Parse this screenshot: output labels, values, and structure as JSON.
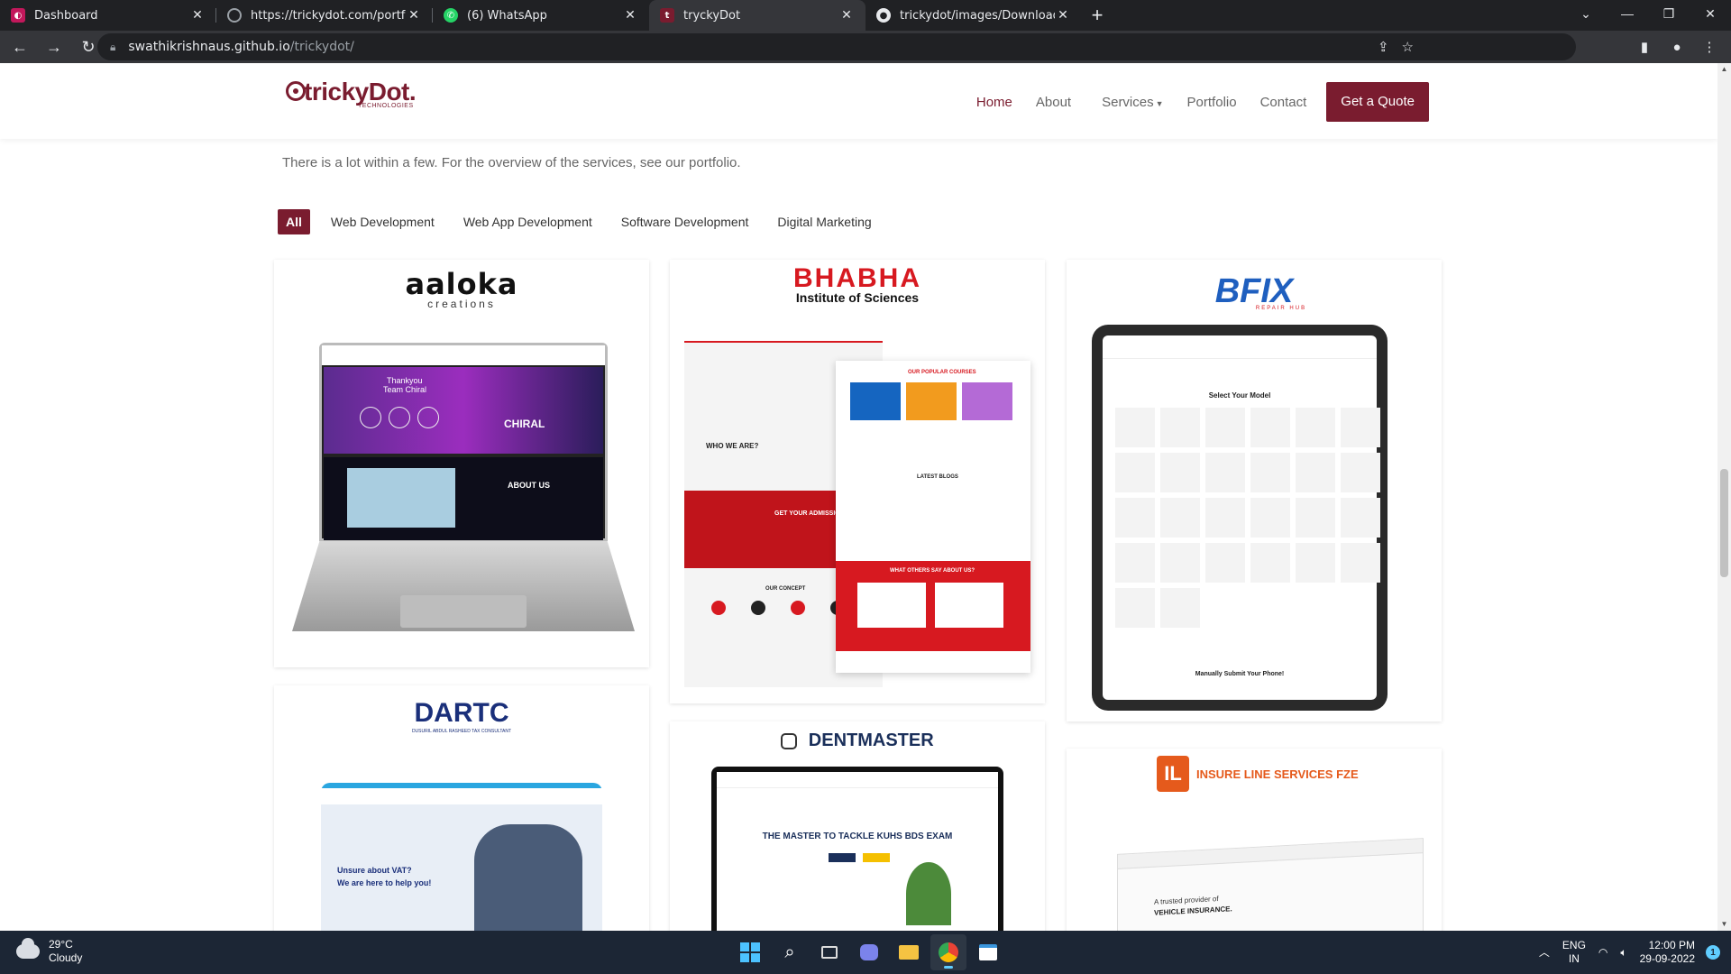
{
  "browser": {
    "tabs": [
      {
        "label": "Dashboard",
        "favicon_color": "#c2185b",
        "active": false
      },
      {
        "label": "https://trickydot.com/portfolio.h",
        "favicon_color": "#9aa0a6",
        "active": false
      },
      {
        "label": "(6) WhatsApp",
        "favicon_color": "#25d366",
        "active": false
      },
      {
        "label": "tryckyDot",
        "favicon_color": "#7a1c2f",
        "active": true
      },
      {
        "label": "trickydot/images/Downloads at r",
        "favicon_color": "#e8eaed",
        "active": false
      }
    ],
    "url_host": "swathikrishnaus.github.io",
    "url_path": "/trickydot/"
  },
  "site": {
    "logo_name": "trickyDot.",
    "logo_sub": "TECHNOLOGIES",
    "nav": {
      "home": "Home",
      "about": "About",
      "services": "Services",
      "portfolio": "Portfolio",
      "contact": "Contact",
      "quote": "Get a Quote"
    },
    "intro": "There is a lot within a few. For the overview of the services, see our portfolio.",
    "filters": [
      "All",
      "Web Development",
      "Web App Development",
      "Software Development",
      "Digital Marketing"
    ],
    "cards": {
      "aaloka": {
        "brand": "aaloka",
        "sub": "creations",
        "hero_line1": "Thankyou",
        "hero_line2": "Team Chiral",
        "poster": "CHIRAL",
        "about": "ABOUT US"
      },
      "bhabha": {
        "brand": "BHABHA",
        "sub": "Institute of Sciences",
        "who": "WHO WE ARE?",
        "courses": "OUR POPULAR COURSES",
        "admission": "GET YOUR ADMISSION",
        "blogs": "LATEST BLOGS",
        "concept": "OUR CONCEPT",
        "others": "WHAT OTHERS SAY ABOUT US?"
      },
      "bfix": {
        "brand": "BFIX",
        "tag": "REPAIR HUB",
        "select": "Select Your Model",
        "submit": "Manually Submit Your Phone!"
      },
      "dartc": {
        "brand": "DARTC",
        "sub": "DUSURIL ABDUL RASHEED TAX CONSULTANT",
        "q1": "Unsure about VAT?",
        "q2": "We are here to help you!"
      },
      "dentmaster": {
        "brand": "DENTMASTER",
        "headline": "THE MASTER TO TACKLE KUHS BDS EXAM"
      },
      "insure": {
        "brand": "INSURE LINE SERVICES FZE",
        "tag1": "A trusted provider of",
        "tag2": "VEHICLE INSURANCE."
      }
    }
  },
  "taskbar": {
    "temp": "29°C",
    "weather": "Cloudy",
    "lang1": "ENG",
    "lang2": "IN",
    "time": "12:00 PM",
    "date": "29-09-2022",
    "notif": "1"
  }
}
